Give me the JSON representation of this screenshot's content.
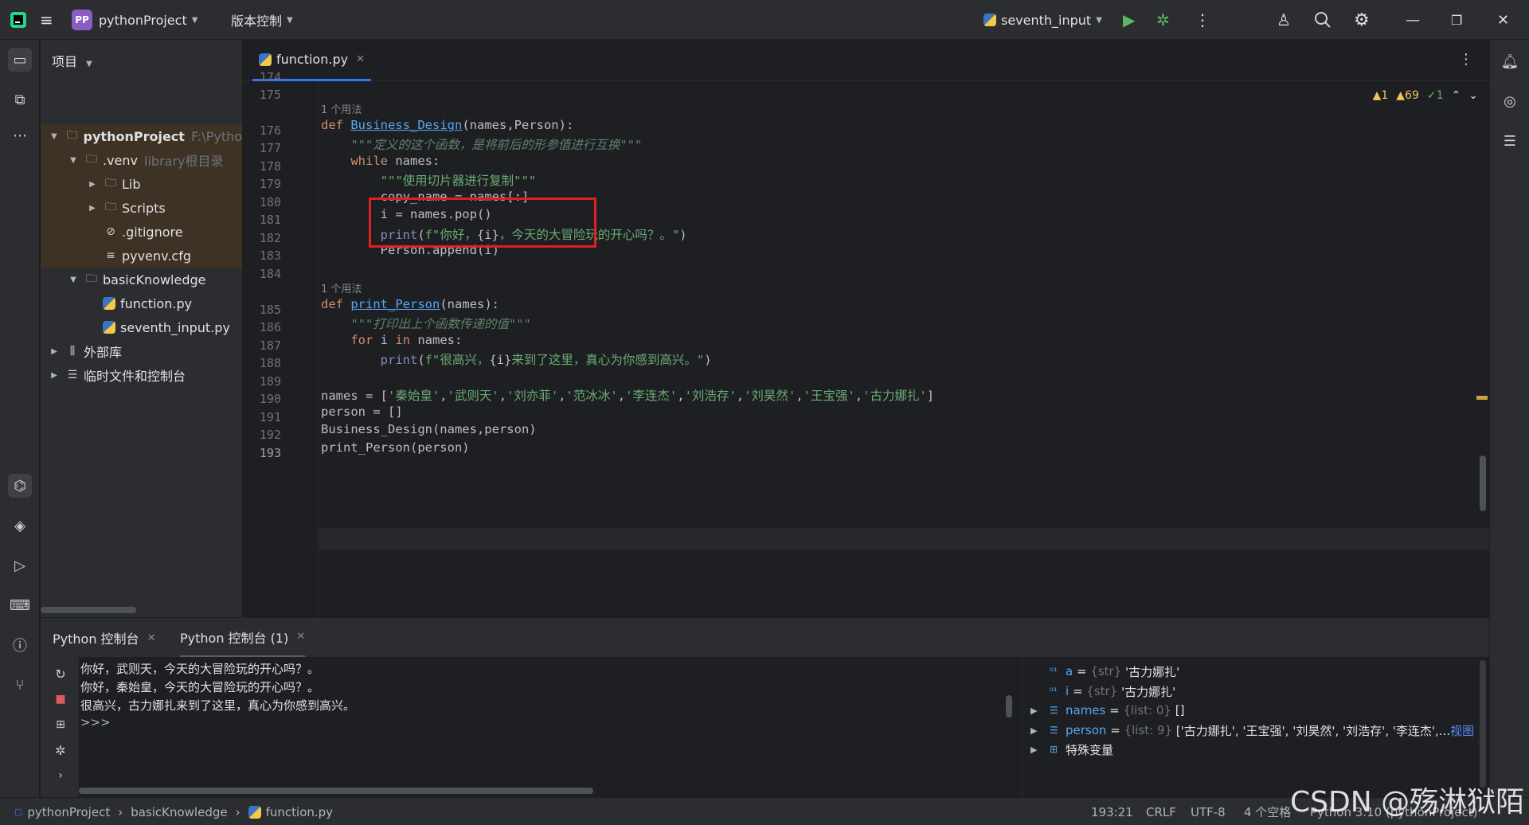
{
  "titlebar": {
    "project_badge": "PP",
    "project_name": "pythonProject",
    "vcs_menu": "版本控制",
    "run_config": "seventh_input"
  },
  "project_panel": {
    "header": "项目",
    "tree": [
      {
        "label": "pythonProject",
        "hint": "F:\\Pytho",
        "level": 0,
        "expanded": true,
        "icon": "folder-icon",
        "bold": true
      },
      {
        "label": ".venv",
        "hint": "library根目录",
        "level": 1,
        "expanded": true,
        "icon": "folder-icon"
      },
      {
        "label": "Lib",
        "hint": "",
        "level": 2,
        "expanded": false,
        "icon": "folder-icon"
      },
      {
        "label": "Scripts",
        "hint": "",
        "level": 2,
        "expanded": false,
        "icon": "folder-icon"
      },
      {
        "label": ".gitignore",
        "hint": "",
        "level": 2,
        "icon": "ignore-file-icon"
      },
      {
        "label": "pyvenv.cfg",
        "hint": "",
        "level": 2,
        "icon": "config-file-icon"
      },
      {
        "label": "basicKnowledge",
        "hint": "",
        "level": 1,
        "expanded": true,
        "icon": "folder-icon"
      },
      {
        "label": "function.py",
        "hint": "",
        "level": 2,
        "icon": "python-file-icon"
      },
      {
        "label": "seventh_input.py",
        "hint": "",
        "level": 2,
        "icon": "python-file-icon"
      },
      {
        "label": "外部库",
        "hint": "",
        "level": 0,
        "expanded": false,
        "icon": "library-icon"
      },
      {
        "label": "临时文件和控制台",
        "hint": "",
        "level": 0,
        "expanded": false,
        "icon": "scratch-icon"
      }
    ]
  },
  "editor": {
    "tab_label": "function.py",
    "inspections": {
      "errors": "1",
      "warnings": "69",
      "ok": "1"
    },
    "usage_hint": "1 个用法",
    "line_numbers": [
      "174",
      "175",
      "176",
      "177",
      "178",
      "179",
      "180",
      "181",
      "182",
      "183",
      "184",
      "185",
      "186",
      "187",
      "188",
      "189",
      "190",
      "191",
      "192",
      "193"
    ],
    "current_line": "193"
  },
  "console": {
    "tab1": "Python 控制台",
    "tab2": "Python 控制台 (1)",
    "output": [
      "你好，武则天，今天的大冒险玩的开心吗？。",
      "你好，秦始皇，今天的大冒险玩的开心吗？。",
      "很高兴，古力娜扎来到了这里，真心为你感到高兴。",
      ">>>"
    ]
  },
  "variables": [
    {
      "name": "a",
      "type": "{str}",
      "value": "'古力娜扎'",
      "expandable": false,
      "icon": "string-var-icon"
    },
    {
      "name": "i",
      "type": "{str}",
      "value": "'古力娜扎'",
      "expandable": false,
      "icon": "string-var-icon"
    },
    {
      "name": "names",
      "type": "{list: 0}",
      "value": "[]",
      "expandable": true,
      "icon": "list-var-icon"
    },
    {
      "name": "person",
      "type": "{list: 9}",
      "value": "['古力娜扎', '王宝强', '刘昊然', '刘浩存', '李连杰',...",
      "extra": "视图",
      "expandable": true,
      "icon": "list-var-icon"
    },
    {
      "name": "特殊变量",
      "type": "",
      "value": "",
      "expandable": true,
      "icon": "special-var-icon"
    }
  ],
  "statusbar": {
    "breadcrumb": [
      "pythonProject",
      "basicKnowledge",
      "function.py"
    ],
    "position": "193:21",
    "line_sep": "CRLF",
    "encoding": "UTF-8",
    "indent": "4 个空格",
    "interpreter": "Python 3.10 (pythonProject)"
  },
  "watermark": "CSDN @殇淋狱陌",
  "colors": {
    "accent": "#3574f0",
    "highlight_box": "#e02020",
    "keyword": "#cf8e6d",
    "function": "#56a8f5",
    "string": "#6aab73"
  }
}
